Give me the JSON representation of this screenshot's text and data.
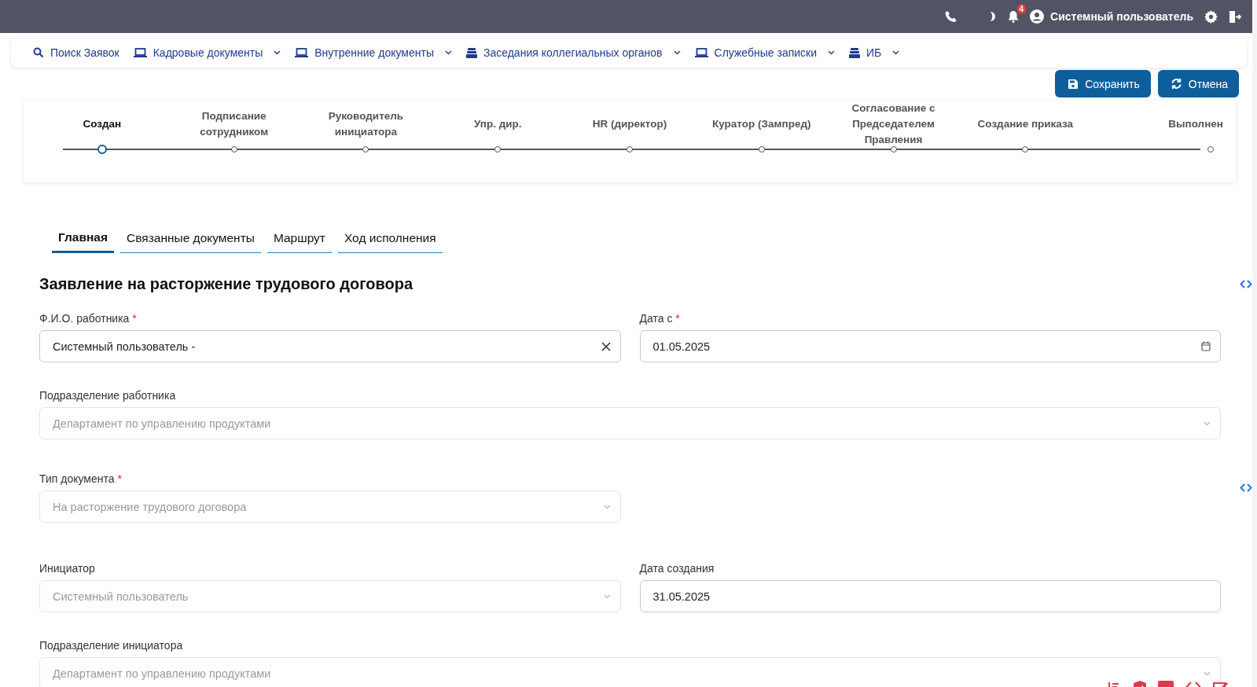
{
  "topbar": {
    "notification_count": "4",
    "user_name": "Системный пользователь"
  },
  "nav": [
    {
      "label": "Поиск Заявок",
      "kind": "search",
      "dropdown": false
    },
    {
      "label": "Кадровые документы",
      "kind": "laptop",
      "dropdown": true
    },
    {
      "label": "Внутренние документы",
      "kind": "laptop",
      "dropdown": true
    },
    {
      "label": "Заседания коллегиальных органов",
      "kind": "tray",
      "dropdown": true
    },
    {
      "label": "Служебные записки",
      "kind": "laptop",
      "dropdown": true
    },
    {
      "label": "ИБ",
      "kind": "tray",
      "dropdown": true
    }
  ],
  "actions": [
    {
      "label": "Сохранить",
      "kind": "save"
    },
    {
      "label": "Отмена",
      "kind": "refresh"
    }
  ],
  "stepper": [
    {
      "label": "Создан",
      "selected": true
    },
    {
      "label": "Подписание сотрудником",
      "selected": false
    },
    {
      "label": "Руководитель инициатора",
      "selected": false
    },
    {
      "label": "Упр. дир.",
      "selected": false
    },
    {
      "label": "HR (директор)",
      "selected": false
    },
    {
      "label": "Куратор (Зампред)",
      "selected": false
    },
    {
      "label": "Согласование с Председателем Правления",
      "selected": false
    },
    {
      "label": "Создание приказа",
      "selected": false
    },
    {
      "label": "Выполнен",
      "selected": false
    }
  ],
  "tabs": [
    {
      "label": "Главная",
      "selected": true
    },
    {
      "label": "Связанные документы",
      "selected": false
    },
    {
      "label": "Маршрут",
      "selected": false
    },
    {
      "label": "Ход исполнения",
      "selected": false
    }
  ],
  "form": {
    "title": "Заявление на расторжение трудового договора",
    "rows": [
      [
        {
          "label": "Ф.И.О. работника",
          "required_mark": "*",
          "kind": "clearable",
          "value": "Системный пользователь -",
          "disabled": false
        },
        {
          "label": "Дата с",
          "required_mark": "*",
          "kind": "date",
          "value": "01.05.2025",
          "disabled": false
        }
      ],
      [
        {
          "label": "Подразделение работника",
          "kind": "select",
          "value": "Департамент по управлению продуктами",
          "disabled": true,
          "wide": true
        }
      ],
      [
        {
          "label": "Тип документа",
          "required_mark": "*",
          "kind": "select",
          "value": "На расторжение трудового договора",
          "disabled": true
        }
      ],
      [
        {
          "label": "Инициатор",
          "kind": "select",
          "value": "Системный пользователь",
          "disabled": true
        },
        {
          "label": "Дата создания",
          "kind": "text",
          "value": "31.05.2025",
          "disabled": false
        }
      ],
      [
        {
          "label": "Подразделение инициатора",
          "kind": "select",
          "value": "Департамент по управлению продуктами",
          "disabled": true,
          "wide": true
        }
      ]
    ]
  }
}
